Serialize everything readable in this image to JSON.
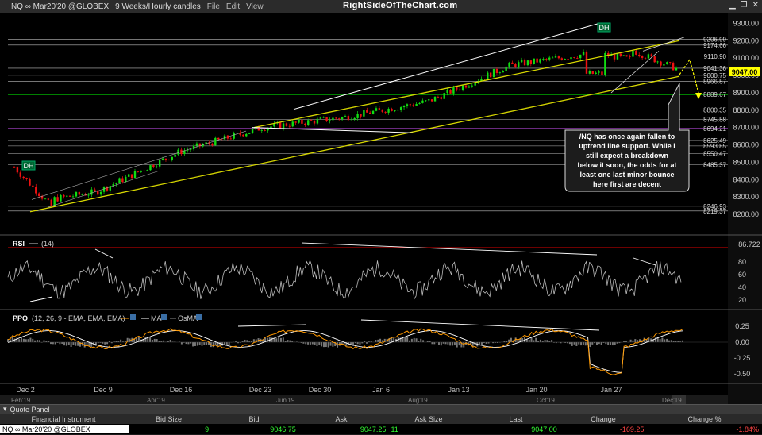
{
  "toolbar": {
    "symbol": "NQ ∞ Mar20'20 @GLOBEX",
    "timeframe": "9 Weeks/Hourly candles",
    "menu_file": "File",
    "menu_edit": "Edit",
    "menu_view": "View",
    "brand": "RightSideOfTheChart.com"
  },
  "price_axis": {
    "ticks": [
      "9300.00",
      "9200.00",
      "9100.00",
      "9000.00",
      "8900.00",
      "8800.00",
      "8700.00",
      "8600.00",
      "8500.00",
      "8400.00",
      "8300.00",
      "8200.00"
    ],
    "levels": [
      "9206.99",
      "9174.66",
      "9110.90",
      "9041.36",
      "9000.75",
      "8966.87",
      "8889.67",
      "8800.35",
      "8745.88",
      "8694.21",
      "8625.49",
      "8593.85",
      "8550.47",
      "8485.37",
      "8246.93",
      "8219.37"
    ],
    "last_price": "9047.00"
  },
  "annotations": {
    "dh_left": "DH",
    "dh_right": "DH",
    "callout_lines": [
      "/NQ has once again fallen to",
      "uptrend line support. While I",
      "still expect a breakdown",
      "below it soon, the odds for at",
      "least one last minor bounce",
      "here first are decent"
    ]
  },
  "rsi": {
    "label": "RSI",
    "params": "(14)",
    "value": "86.722",
    "ticks": [
      "80",
      "60",
      "40",
      "20"
    ]
  },
  "ppo": {
    "label": "PPO",
    "params": "(12, 26, 9 - EMA, EMA, EMA)",
    "legend_ma": "MA",
    "legend_osma": "OsMA",
    "ticks": [
      "0.25",
      "0.00",
      "-0.25",
      "-0.50"
    ]
  },
  "time_axis": {
    "labels": [
      "Dec 2",
      "Dec 9",
      "Dec 16",
      "Dec 23",
      "Dec 30",
      "Jan 6",
      "Jan 13",
      "Jan 20",
      "Jan 27"
    ],
    "overview_labels": [
      "Feb'19",
      "Apr'19",
      "Jun'19",
      "Aug'19",
      "Oct'19",
      "Dec'19"
    ]
  },
  "quote_panel": {
    "title": "Quote Panel",
    "headers": [
      "Financial Instrument",
      "Bid Size",
      "Bid",
      "Ask",
      "Ask Size",
      "Last",
      "Change",
      "Change %"
    ],
    "instrument": "NQ ∞ Mar20'20 @GLOBEX",
    "bid_size": "9",
    "bid": "9046.75",
    "ask": "9047.25",
    "ask_size": "11",
    "last": "9047.00",
    "change": "-169.25",
    "change_pct": "-1.84%"
  },
  "colors": {
    "background": "#000000",
    "trendline": "#d7d700",
    "channel": "#ffffff",
    "level_line": "#bbbbbb",
    "highlight_green": "#00cc00",
    "highlight_purple": "#aa44cc",
    "candle_up": "#11dd11",
    "candle_down": "#ee1111",
    "ppo_line": "#ff9900",
    "ppo_signal": "#ffffff",
    "last_price_box": "#ffff00"
  },
  "chart_data": {
    "type": "candlestick",
    "title": "NQ ∞ Mar20'20 @GLOBEX 9 Weeks/Hourly candles",
    "x": [
      "Dec 2",
      "Dec 9",
      "Dec 16",
      "Dec 23",
      "Dec 30",
      "Jan 6",
      "Jan 13",
      "Jan 20",
      "Jan 27"
    ],
    "close_approx": [
      8250,
      8330,
      8560,
      8700,
      8760,
      8850,
      9060,
      9130,
      9047
    ],
    "ylim": [
      8150,
      9320
    ],
    "last": 9047.0,
    "horizontal_levels": [
      9206.99,
      9174.66,
      9110.9,
      9041.36,
      9000.75,
      8966.87,
      8889.67,
      8800.35,
      8745.88,
      8694.21,
      8625.49,
      8593.85,
      8550.47,
      8485.37,
      8246.93,
      8219.37
    ],
    "rsi_last": 86.722,
    "rsi_ylim": [
      0,
      100
    ],
    "ppo_ylim": [
      -0.6,
      0.4
    ]
  }
}
